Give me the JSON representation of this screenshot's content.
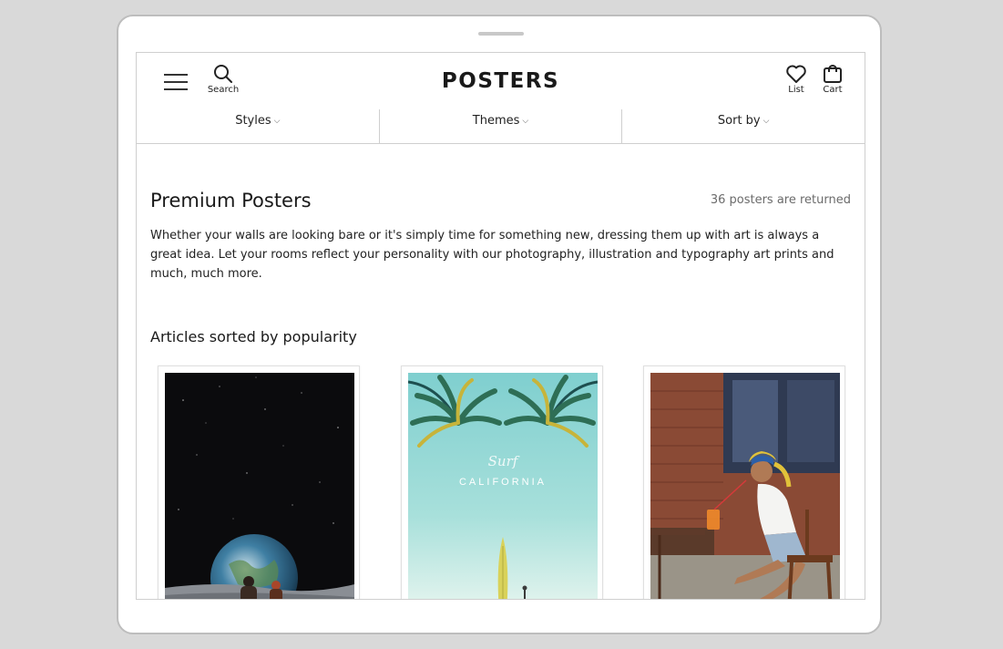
{
  "header": {
    "logo": "POSTERS",
    "search_label": "Search",
    "list_label": "List",
    "cart_label": "Cart"
  },
  "filters": [
    {
      "label": "Styles"
    },
    {
      "label": "Themes"
    },
    {
      "label": "Sort by"
    }
  ],
  "main": {
    "title": "Premium Posters",
    "count_text": "36 posters are returned",
    "description": "Whether your walls are looking bare or it's simply time for something new, dressing them up with art is always a great idea. Let your rooms reflect your personality with our photography, illustration and typography art prints and much, much more.",
    "subtitle": "Articles sorted by popularity"
  },
  "posters": [
    {
      "image": "space-earth-figures"
    },
    {
      "image": "palm-trees-surfboard",
      "script_text": "Surf",
      "caption": "CALIFORNIA"
    },
    {
      "image": "woman-on-chair-with-drink"
    }
  ],
  "colors": {
    "background": "#d9d9d9",
    "text": "#1a1a1a",
    "muted": "#6b6b6b",
    "border": "#cfcfcf"
  }
}
